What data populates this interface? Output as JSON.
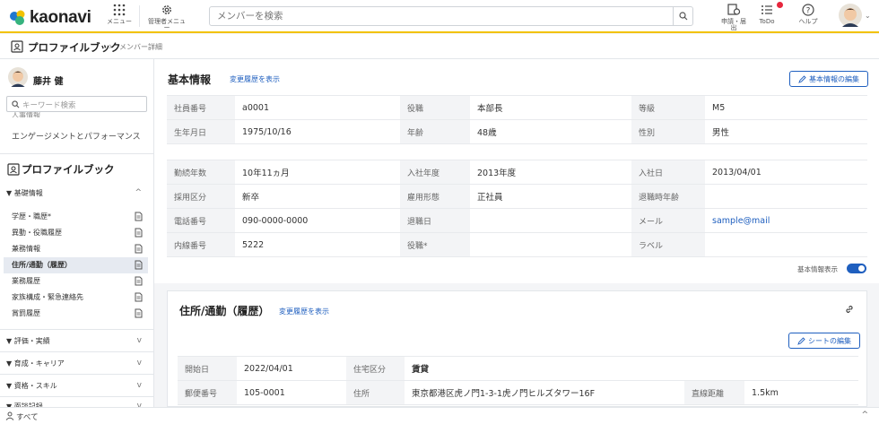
{
  "topbar": {
    "logo_text": "kaonavi",
    "menu_label": "メニュー",
    "admin_menu_label": "管理者メニュー",
    "search_placeholder": "メンバーを検索",
    "apply_label": "申請・届出",
    "todo_label": "ToDo",
    "help_label": "ヘルプ",
    "badge_color": "#e6263d",
    "accent_color": "#f2c200"
  },
  "breadcrumb": {
    "main": "プロファイルブック",
    "separator": "›",
    "sub": "メンバー詳細"
  },
  "sidebar": {
    "member_name": "藤井 健",
    "search_placeholder": "キーワード検索",
    "cut_item": "人事情報",
    "engagement": "エンゲージメントとパフォーマンス",
    "profilebook_title": "プロファイルブック",
    "sections": [
      {
        "label": "▼ 基礎情報",
        "chevron": "^"
      },
      {
        "label": "▼ 評価・実績",
        "chevron": "v"
      },
      {
        "label": "▼ 育成・キャリア",
        "chevron": "v"
      },
      {
        "label": "▼ 資格・スキル",
        "chevron": "v"
      },
      {
        "label": "▼ 面談記録",
        "chevron": "v"
      }
    ],
    "items": [
      {
        "label": "学歴・職歴*"
      },
      {
        "label": "異動・役職履歴"
      },
      {
        "label": "兼務情報"
      },
      {
        "label": "住所/通勤（履歴）",
        "active": true
      },
      {
        "label": "業務履歴"
      },
      {
        "label": "家族構成・緊急連絡先"
      },
      {
        "label": "賞罰履歴"
      }
    ],
    "footer_label": "すべて"
  },
  "basic_info": {
    "title": "基本情報",
    "history_link": "変更履歴を表示",
    "edit_button": "基本情報の編集",
    "table1": [
      [
        "社員番号",
        "a0001",
        "役職",
        "本部長",
        "等級",
        "M5"
      ],
      [
        "生年月日",
        "1975/10/16",
        "年齢",
        "48歳",
        "性別",
        "男性"
      ]
    ],
    "table2": [
      [
        "勤続年数",
        "10年11ヵ月",
        "入社年度",
        "2013年度",
        "入社日",
        "2013/04/01"
      ],
      [
        "採用区分",
        "新卒",
        "雇用形態",
        "正社員",
        "退職時年齢",
        ""
      ],
      [
        "電話番号",
        "090-0000-0000",
        "退職日",
        "",
        "メール",
        "sample@mail"
      ],
      [
        "内線番号",
        "5222",
        "役職*",
        "",
        "ラベル",
        ""
      ]
    ],
    "toggle_label": "基本情報表示",
    "toggle_on": true
  },
  "address": {
    "title": "住所/通勤（履歴）",
    "history_link": "変更履歴を表示",
    "edit_button": "シートの編集",
    "rows": [
      [
        "開始日",
        "2022/04/01",
        "住宅区分",
        "賃貸",
        "",
        ""
      ],
      [
        "郵便番号",
        "105-0001",
        "住所",
        "東京都港区虎ノ門1-3-1虎ノ門ヒルズタワー16F",
        "直線距離",
        "1.5km"
      ]
    ]
  }
}
